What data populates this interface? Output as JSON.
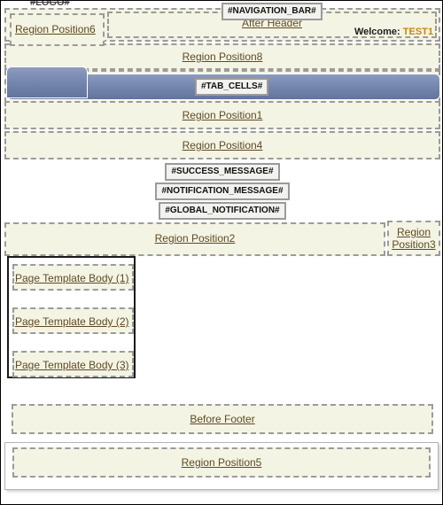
{
  "page": {
    "logo": "#LOGO#",
    "navigation_bar": "#NAVIGATION_BAR#",
    "welcome_prefix": "Welcome: ",
    "welcome_user": "TEST1"
  },
  "regions": {
    "position6": "Region Position6",
    "after_header": "After Header",
    "position8": "Region Position8",
    "position1": "Region Position1",
    "position4": "Region Position4",
    "position2": "Region Position2",
    "position3": "Region\nPosition3",
    "position3_line1": "Region",
    "position3_line2": "Position3",
    "before_footer": "Before Footer",
    "position5": "Region Position5"
  },
  "tabs": {
    "tab_cells": "#TAB_CELLS#"
  },
  "messages": [
    "#SUCCESS_MESSAGE#",
    "#NOTIFICATION_MESSAGE#",
    "#GLOBAL_NOTIFICATION#"
  ],
  "body": [
    "Page Template Body (1)",
    "Page Template Body (2)",
    "Page Template Body (3)"
  ],
  "colors": {
    "region_fill": "#f4f4e4",
    "region_border": "#9b9b9b",
    "link_text": "#5e4a23",
    "tab_gradient_top": "#8d9cbe",
    "tab_gradient_bottom": "#63749d",
    "user_accent": "#c8860d",
    "body_box_border": "#1a1a1a"
  }
}
